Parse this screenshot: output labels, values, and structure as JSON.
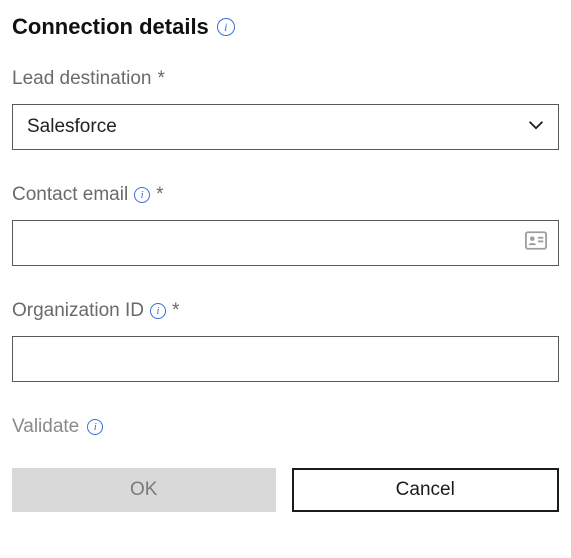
{
  "header": {
    "title": "Connection details"
  },
  "fields": {
    "lead_destination": {
      "label": "Lead destination",
      "required": "*",
      "value": "Salesforce"
    },
    "contact_email": {
      "label": "Contact email",
      "required": "*",
      "value": ""
    },
    "organization_id": {
      "label": "Organization ID",
      "required": "*",
      "value": ""
    }
  },
  "actions": {
    "validate": "Validate",
    "ok": "OK",
    "cancel": "Cancel"
  }
}
